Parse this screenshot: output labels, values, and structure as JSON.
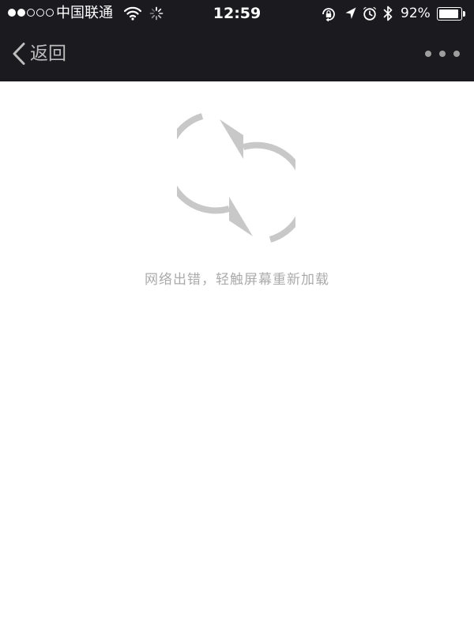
{
  "status_bar": {
    "signal": {
      "full": 2,
      "total": 5
    },
    "carrier": "中国联通",
    "time": "12:59",
    "battery_percent": "92%",
    "battery_level": 0.92,
    "icons": [
      "wifi-icon",
      "activity-spinner-icon",
      "rotation-lock-icon",
      "location-arrow-icon",
      "alarm-clock-icon",
      "bluetooth-icon",
      "battery-icon"
    ]
  },
  "nav": {
    "back_label": "返回",
    "more_icon": "more-dots-icon"
  },
  "content": {
    "reload_icon": "reload-arrows-icon",
    "message": "网络出错，轻触屏幕重新加载"
  },
  "colors": {
    "header_background": "#1a1a1f",
    "nav_text": "#bdbdbd",
    "reload_icon": "#c8c8c8",
    "message_text": "#ababab",
    "page_background": "#ffffff"
  }
}
